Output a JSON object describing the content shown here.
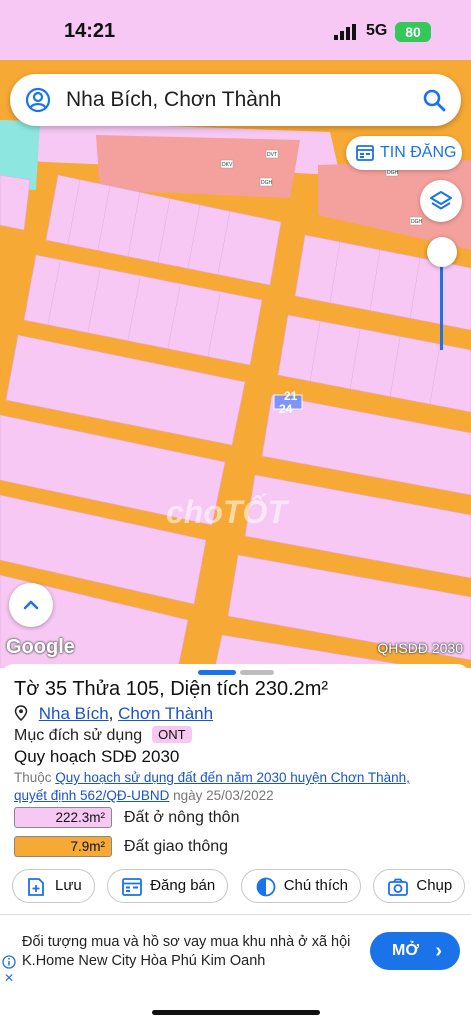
{
  "status_bar": {
    "time": "14:21",
    "network": "5G",
    "battery": "80"
  },
  "search": {
    "query": "Nha Bích, Chơn Thành",
    "account_icon": "account-circle-icon",
    "search_icon": "search-icon"
  },
  "map": {
    "post_button": "TIN ĐĂNG",
    "parcel_labels": [
      "21",
      "24"
    ],
    "building_labels": [
      "DKV",
      "DVT",
      "DGH",
      "DGH",
      "DGH"
    ],
    "watermark": "choTỐT",
    "attribution": "Google",
    "layer_tag": "QHSDĐ 2030",
    "colors": {
      "residential": "#f6c8f3",
      "road": "#f6a935",
      "commercial": "#f4a09c",
      "green": "#8ee6e0"
    }
  },
  "parcel": {
    "title": "Tờ 35 Thửa 105, Diện tích 230.2m²",
    "location": {
      "commune": "Nha Bích",
      "district": "Chơn Thành",
      "separator": ","
    },
    "purpose_label": "Mục đích sử dụng",
    "purpose_code": "ONT",
    "plan_title": "Quy hoạch SDĐ 2030",
    "belongs_prefix": "Thuộc",
    "plan_link": "Quy hoạch sử dụng đất đến năm 2030 huyện Chơn Thành,",
    "decision_link": "quyết định 562/QĐ-UBND",
    "decision_date": "ngày 25/03/2022",
    "legend": [
      {
        "value": "222.3m²",
        "name": "Đất ở nông thôn",
        "color": "#f6c8f3"
      },
      {
        "value": "7.9m²",
        "name": "Đất giao thông",
        "color": "#f6a935"
      }
    ]
  },
  "actions": [
    {
      "label": "Lưu",
      "icon": "bookmark-add-icon"
    },
    {
      "label": "Đăng bán",
      "icon": "listing-icon"
    },
    {
      "label": "Chú thích",
      "icon": "contrast-icon"
    },
    {
      "label": "Chụp",
      "icon": "camera-icon"
    }
  ],
  "ad": {
    "text": "Đối tượng mua và hồ sơ vay mua khu nhà ở xã hội K.Home New City Hòa Phú Kim Oanh",
    "cta": "MỞ",
    "close": "✕"
  }
}
